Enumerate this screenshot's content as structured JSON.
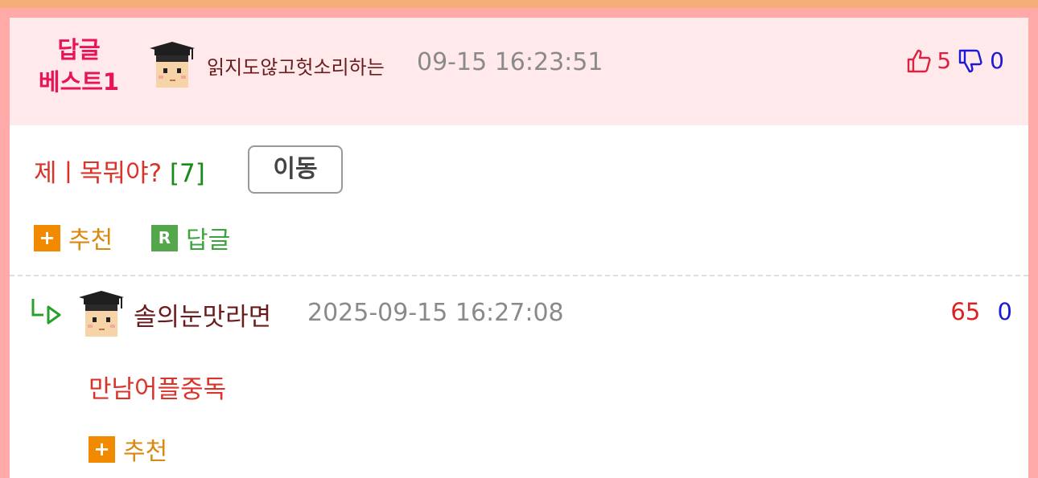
{
  "best_reply": {
    "label_line1": "답글",
    "label_line2": "베스트1",
    "nickname": "읽지도않고헛소리하는",
    "time": "09-15 16:23:51",
    "up_count": "5",
    "down_count": "0"
  },
  "post": {
    "title": "제ㅣ목뭐야?",
    "comment_count": "[7]",
    "move_label": "이동"
  },
  "actions": {
    "recommend_label": "추천",
    "reply_label": "답글"
  },
  "reply": {
    "nickname": "솔의눈맛라면",
    "time": "2025-09-15 16:27:08",
    "up_count": "65",
    "down_count": "0",
    "text": "만남어플중독",
    "recommend_label": "추천"
  },
  "colors": {
    "page_bg": "#ffaaa8",
    "top_bar": "#f5ad7a",
    "header_bg": "#ffe9ea",
    "best_label": "#e8145a",
    "title_red": "#d9332a",
    "count_green": "#1a8a1a",
    "up_red": "#e02040",
    "down_blue": "#1a1ad8",
    "recommend_orange": "#f28a00",
    "reply_green": "#54a64a"
  },
  "icons": {
    "avatar": "graduate-avatar-icon",
    "thumbs_up": "thumbs-up-icon",
    "thumbs_down": "thumbs-down-icon",
    "plus": "plus-square-icon",
    "reply": "r-square-icon",
    "reply_arrow": "reply-arrow-icon"
  }
}
